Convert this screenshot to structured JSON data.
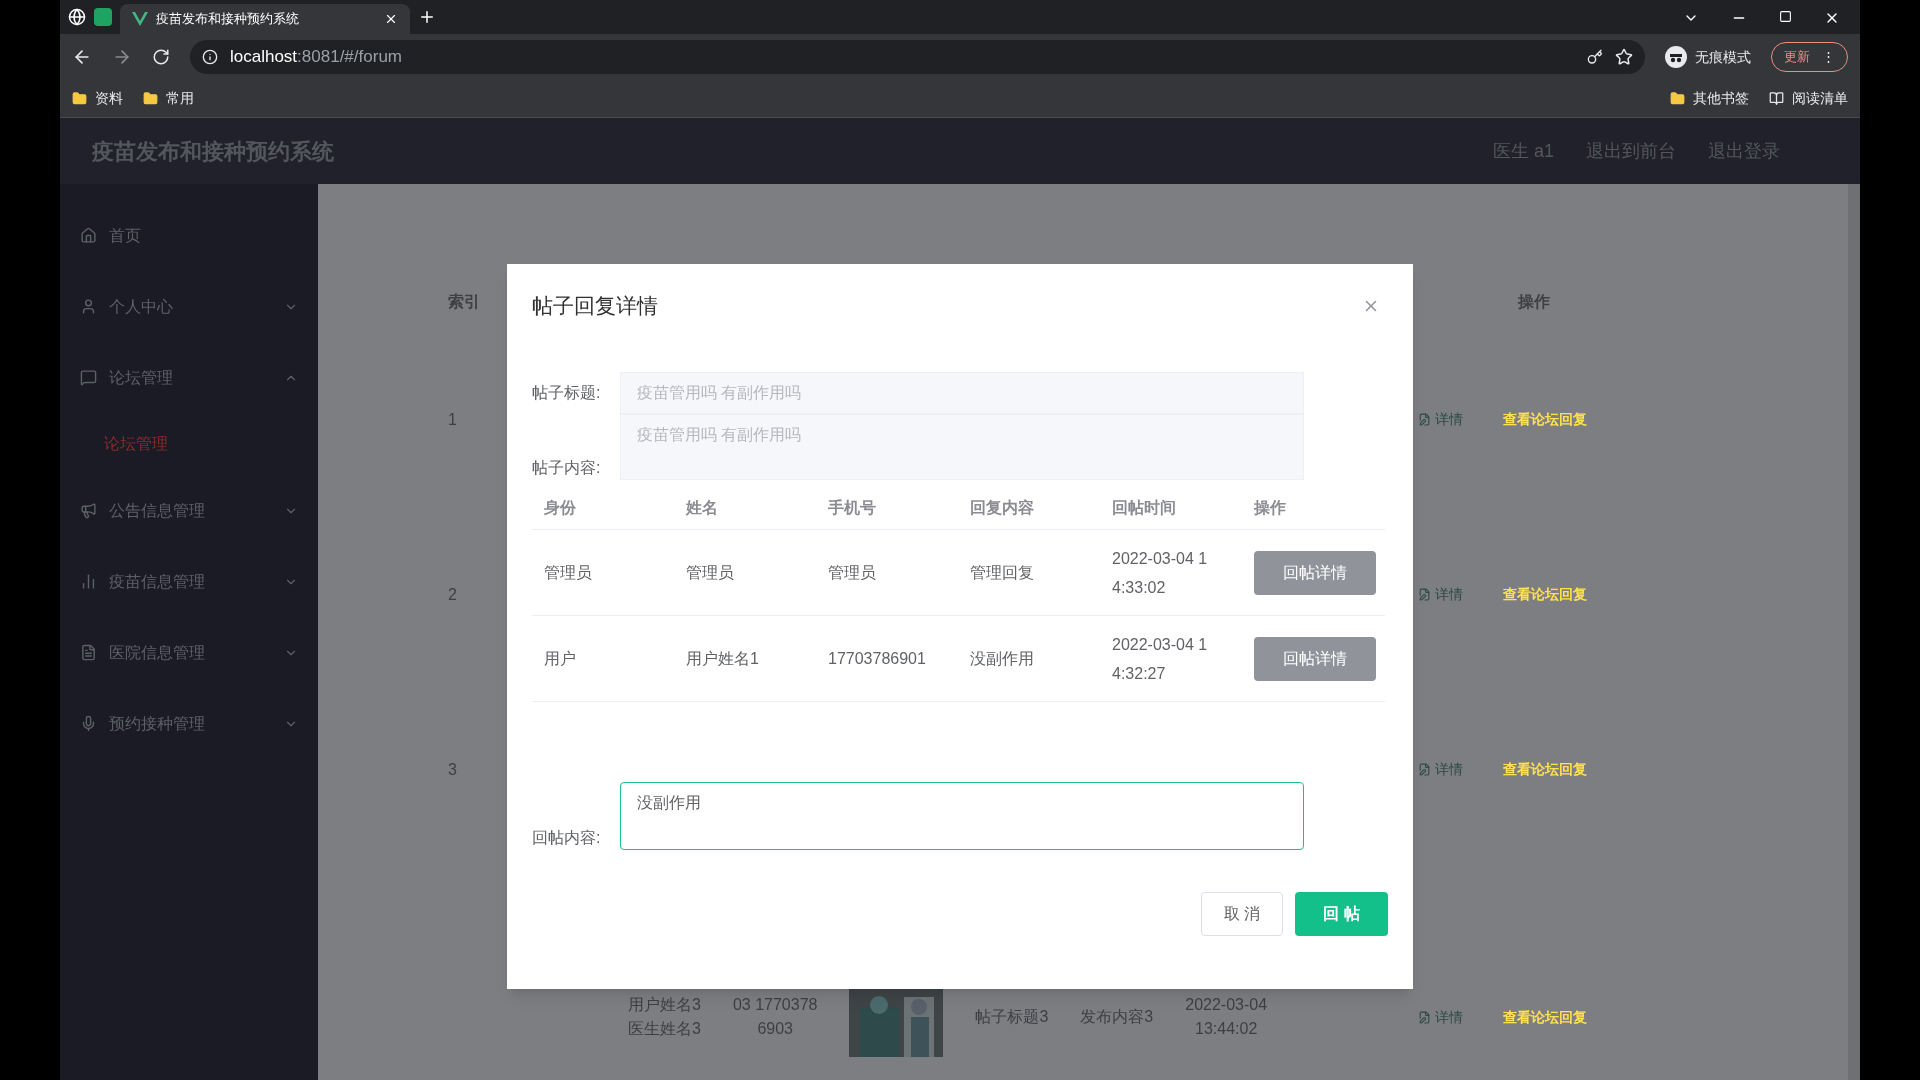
{
  "browser": {
    "tab_title": "疫苗发布和接种预约系统",
    "url_host": "localhost",
    "url_rest": ":8081/#/forum",
    "profile": "无痕模式",
    "update": "更新",
    "menu": "⋮",
    "bookmarks": [
      "资料",
      "常用"
    ],
    "bookmarks_right": [
      "其他书签",
      "阅读清单"
    ]
  },
  "app": {
    "title": "疫苗发布和接种预约系统",
    "header_links": [
      "医生 a1",
      "退出到前台",
      "退出登录"
    ]
  },
  "sidebar": {
    "items": [
      {
        "label": "首页"
      },
      {
        "label": "个人中心",
        "expanded": false
      },
      {
        "label": "论坛管理",
        "expanded": true,
        "children": [
          {
            "label": "论坛管理",
            "selected": true
          }
        ]
      },
      {
        "label": "公告信息管理",
        "expanded": false
      },
      {
        "label": "疫苗信息管理",
        "expanded": false
      },
      {
        "label": "医院信息管理",
        "expanded": false
      },
      {
        "label": "预约接种管理",
        "expanded": false
      }
    ]
  },
  "table": {
    "columns": [
      "索引",
      "操作"
    ],
    "rows": [
      {
        "index": "1",
        "actions": [
          "详情",
          "查看论坛回复"
        ]
      },
      {
        "index": "2",
        "actions": [
          "详情",
          "查看论坛回复"
        ]
      },
      {
        "index": "3",
        "actions": [
          "详情",
          "查看论坛回复"
        ]
      },
      {
        "cells": [
          "用户姓名3\n医生姓名3",
          "03 1770378\n6903",
          "帖子标题3",
          "发布内容3",
          "2022-03-04\n13:44:02"
        ],
        "actions": [
          "详情",
          "查看论坛回复"
        ]
      }
    ]
  },
  "dialog": {
    "title": "帖子回复详情",
    "fields": [
      {
        "label": "帖子标题:",
        "value": "疫苗管用吗 有副作用吗",
        "kind": "input"
      },
      {
        "label": "帖子内容:",
        "value": "疫苗管用吗  有副作用吗",
        "kind": "textarea"
      }
    ],
    "reply_table": {
      "columns": [
        "身份",
        "姓名",
        "手机号",
        "回复内容",
        "回帖时间",
        "操作"
      ],
      "rows": [
        {
          "cells": [
            "管理员",
            "管理员",
            "管理员",
            "管理回复",
            "2022-03-04 1\n4:33:02"
          ],
          "button": "回帖详情"
        },
        {
          "cells": [
            "用户",
            "用户姓名1",
            "17703786901",
            "没副作用",
            "2022-03-04 1\n4:32:27"
          ],
          "button": "回帖详情"
        }
      ]
    },
    "reply_field": {
      "label": "回帖内容:",
      "value": "没副作用"
    },
    "buttons": [
      {
        "label": "取 消",
        "kind": "secondary"
      },
      {
        "label": "回 帖",
        "kind": "primary"
      }
    ]
  }
}
